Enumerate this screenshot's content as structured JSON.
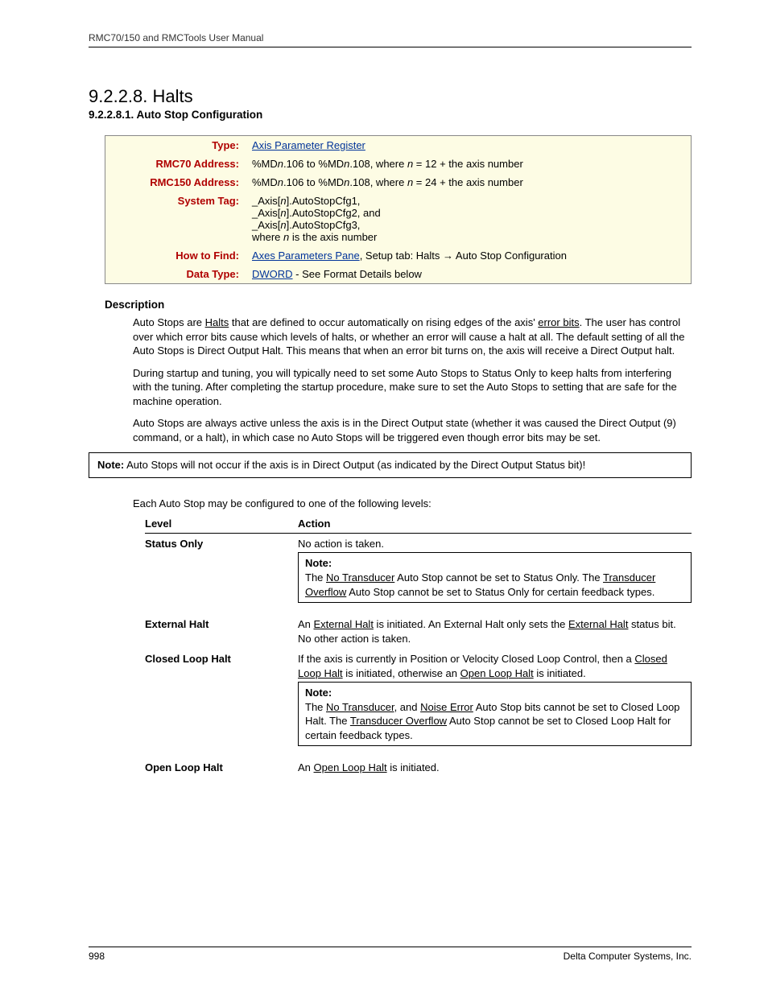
{
  "header": "RMC70/150 and RMCTools User Manual",
  "section_number": "9.2.2.8.",
  "section_title": "Halts",
  "subsection_number": "9.2.2.8.1.",
  "subsection_title": "Auto Stop Configuration",
  "info": {
    "type_label": "Type:",
    "type_value": "Axis Parameter Register",
    "rmc70_label": "RMC70 Address:",
    "rmc70_prefix": "%MD",
    "rmc70_mid1": ".106 to %MD",
    "rmc70_mid2": ".108, where ",
    "rmc70_eq": " = 12 + the axis number",
    "rmc150_label": "RMC150 Address:",
    "rmc150_prefix": "%MD",
    "rmc150_mid1": ".106 to %MD",
    "rmc150_mid2": ".108, where ",
    "rmc150_eq": " = 24 + the axis number",
    "systag_label": "System Tag:",
    "systag_l1a": "_Axis[",
    "systag_l1b": "].AutoStopCfg1,",
    "systag_l2a": "_Axis[",
    "systag_l2b": "].AutoStopCfg2, and",
    "systag_l3a": "_Axis[",
    "systag_l3b": "].AutoStopCfg3,",
    "systag_l4a": "where ",
    "systag_l4b": " is the axis number",
    "howfind_label": "How to Find:",
    "howfind_link": "Axes Parameters Pane",
    "howfind_rest": ", Setup tab: Halts → Auto Stop Configuration",
    "datatype_label": "Data Type:",
    "datatype_link": "DWORD",
    "datatype_rest": " - See Format Details below",
    "n": "n"
  },
  "description": {
    "heading": "Description",
    "p1_a": "Auto Stops are ",
    "p1_link1": "Halts",
    "p1_b": " that are defined to occur automatically on rising edges of the axis' ",
    "p1_link2": "error bits",
    "p1_c": ". The user has control over which error bits cause which levels of halts, or whether an error will cause a halt at all. The default setting of all the Auto Stops is Direct Output Halt. This means that when an error bit turns on, the axis will receive a Direct Output halt.",
    "p2": "During startup and tuning, you will typically need to set some Auto Stops to Status Only to keep halts from interfering with the tuning. After completing the startup procedure, make sure to set the Auto Stops to setting that are safe for the machine operation.",
    "p3": "Auto Stops are always active unless the axis is in the Direct Output state (whether it was caused the Direct Output (9) command, or a halt), in which case no Auto Stops will be triggered even though error bits may be set."
  },
  "note1": {
    "label": "Note:",
    "text": " Auto Stops will not occur if the axis is in Direct Output (as indicated by the Direct Output Status bit)!"
  },
  "levels": {
    "intro": "Each Auto Stop may be configured to one of the following levels:",
    "col1": "Level",
    "col2": "Action",
    "status_only": {
      "name": "Status Only",
      "action": "No action is taken.",
      "note_label": "Note:",
      "note_a": "The ",
      "note_link1": "No Transducer",
      "note_b": " Auto Stop cannot be set to Status Only. The ",
      "note_link2": "Transducer Overflow",
      "note_c": " Auto Stop cannot be set to Status Only for certain feedback types."
    },
    "external_halt": {
      "name": "External Halt",
      "a": "An ",
      "link1": "External Halt",
      "b": " is initiated. An External Halt only sets the ",
      "link2": "External Halt",
      "c": " status bit. No other action is taken."
    },
    "closed_loop": {
      "name": "Closed Loop Halt",
      "a": "If the axis is currently in Position or Velocity Closed Loop Control, then a ",
      "link1": "Closed Loop Halt",
      "b": " is initiated, otherwise an ",
      "link2": "Open Loop Halt",
      "c": " is initiated.",
      "note_label": "Note:",
      "note_a": "The ",
      "note_link1": "No Transducer",
      "note_b": ", and ",
      "note_link2": "Noise Error",
      "note_c": " Auto Stop bits cannot be set to Closed Loop Halt. The ",
      "note_link3": "Transducer Overflow",
      "note_d": " Auto Stop cannot be set to Closed Loop Halt for certain feedback types."
    },
    "open_loop": {
      "name": "Open Loop Halt",
      "a": "An ",
      "link1": "Open Loop Halt",
      "b": " is initiated."
    }
  },
  "footer": {
    "page": "998",
    "company": "Delta Computer Systems, Inc."
  }
}
